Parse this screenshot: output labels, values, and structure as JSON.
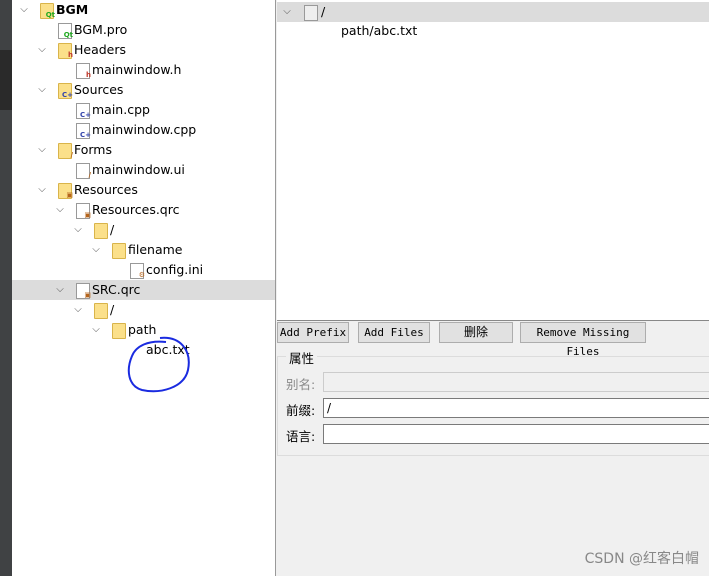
{
  "tree": [
    {
      "label": "BGM",
      "level": 0,
      "arrow": true,
      "icon": "qt-project-folder",
      "bold": true
    },
    {
      "label": "BGM.pro",
      "level": 1,
      "arrow": false,
      "icon": "qt-pro-file"
    },
    {
      "label": "Headers",
      "level": 1,
      "arrow": true,
      "icon": "headers-folder"
    },
    {
      "label": "mainwindow.h",
      "level": 2,
      "arrow": false,
      "icon": "header-file"
    },
    {
      "label": "Sources",
      "level": 1,
      "arrow": true,
      "icon": "sources-folder"
    },
    {
      "label": "main.cpp",
      "level": 2,
      "arrow": false,
      "icon": "cpp-file"
    },
    {
      "label": "mainwindow.cpp",
      "level": 2,
      "arrow": false,
      "icon": "cpp-file"
    },
    {
      "label": "Forms",
      "level": 1,
      "arrow": true,
      "icon": "forms-folder"
    },
    {
      "label": "mainwindow.ui",
      "level": 2,
      "arrow": false,
      "icon": "ui-file"
    },
    {
      "label": "Resources",
      "level": 1,
      "arrow": true,
      "icon": "resources-folder"
    },
    {
      "label": "Resources.qrc",
      "level": 2,
      "arrow": true,
      "icon": "qrc-file"
    },
    {
      "label": "/",
      "level": 3,
      "arrow": true,
      "icon": "folder"
    },
    {
      "label": "filename",
      "level": 4,
      "arrow": true,
      "icon": "folder"
    },
    {
      "label": "config.ini",
      "level": 5,
      "arrow": false,
      "icon": "ini-file"
    },
    {
      "label": "SRC.qrc",
      "level": 2,
      "arrow": true,
      "icon": "qrc-file",
      "selected": true
    },
    {
      "label": "/",
      "level": 3,
      "arrow": true,
      "icon": "folder"
    },
    {
      "label": "path",
      "level": 4,
      "arrow": true,
      "icon": "folder"
    },
    {
      "label": "abc.txt",
      "level": 5,
      "arrow": false,
      "icon": "none"
    }
  ],
  "editor": {
    "prefix_row": "/",
    "file_row": "path/abc.txt"
  },
  "buttons": {
    "add_prefix": "Add Prefix",
    "add_files": "Add Files",
    "delete": "删除",
    "remove_missing": "Remove Missing Files"
  },
  "properties": {
    "title": "属性",
    "alias_label": "别名:",
    "alias_value": "",
    "prefix_label": "前缀:",
    "prefix_value": "/",
    "lang_label": "语言:",
    "lang_value": ""
  },
  "watermark": "CSDN @红客白帽"
}
